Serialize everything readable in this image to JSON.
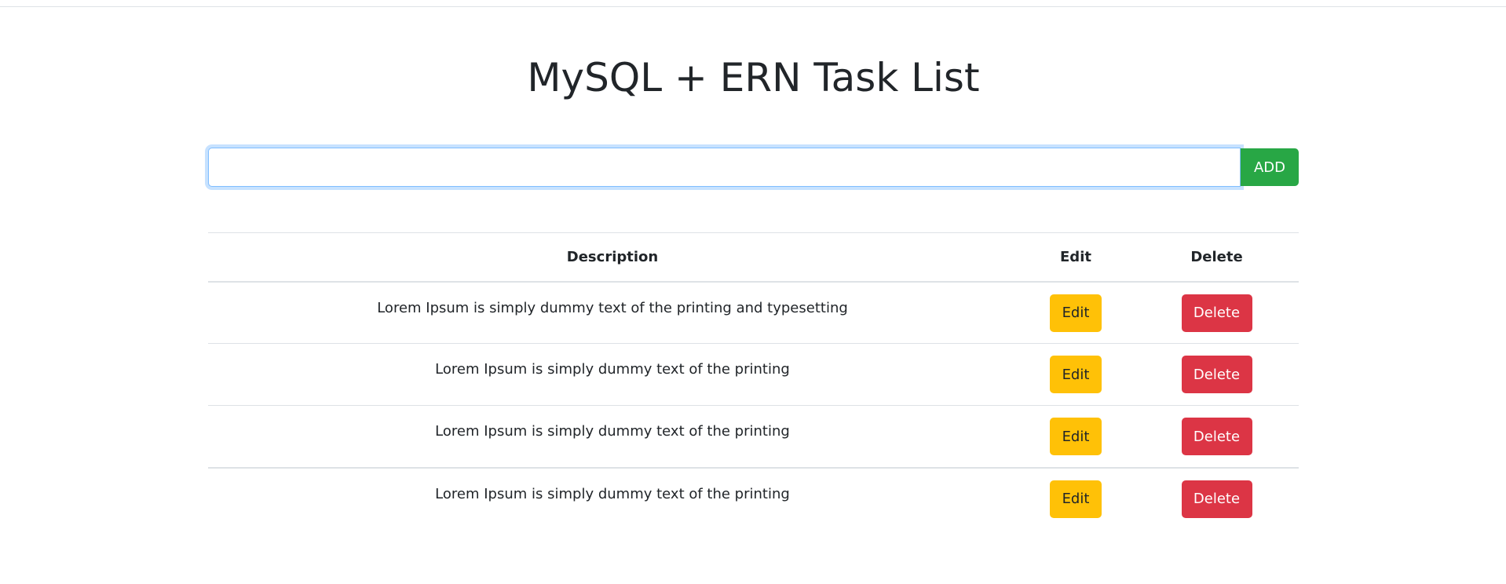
{
  "page": {
    "title": "MySQL + ERN Task List"
  },
  "form": {
    "input_value": "",
    "input_placeholder": "",
    "add_label": "ADD"
  },
  "table": {
    "headers": {
      "description": "Description",
      "edit": "Edit",
      "delete": "Delete"
    },
    "rows": [
      {
        "description": "Lorem Ipsum is simply dummy text of the printing and typesetting",
        "edit_label": "Edit",
        "delete_label": "Delete"
      },
      {
        "description": "Lorem Ipsum is simply dummy text of the printing",
        "edit_label": "Edit",
        "delete_label": "Delete"
      },
      {
        "description": "Lorem Ipsum is simply dummy text of the printing",
        "edit_label": "Edit",
        "delete_label": "Delete"
      },
      {
        "description": "Lorem Ipsum is simply dummy text of the printing",
        "edit_label": "Edit",
        "delete_label": "Delete"
      }
    ]
  },
  "colors": {
    "add": "#28a745",
    "edit": "#ffc107",
    "delete": "#dc3545",
    "focus": "#80bdff"
  }
}
